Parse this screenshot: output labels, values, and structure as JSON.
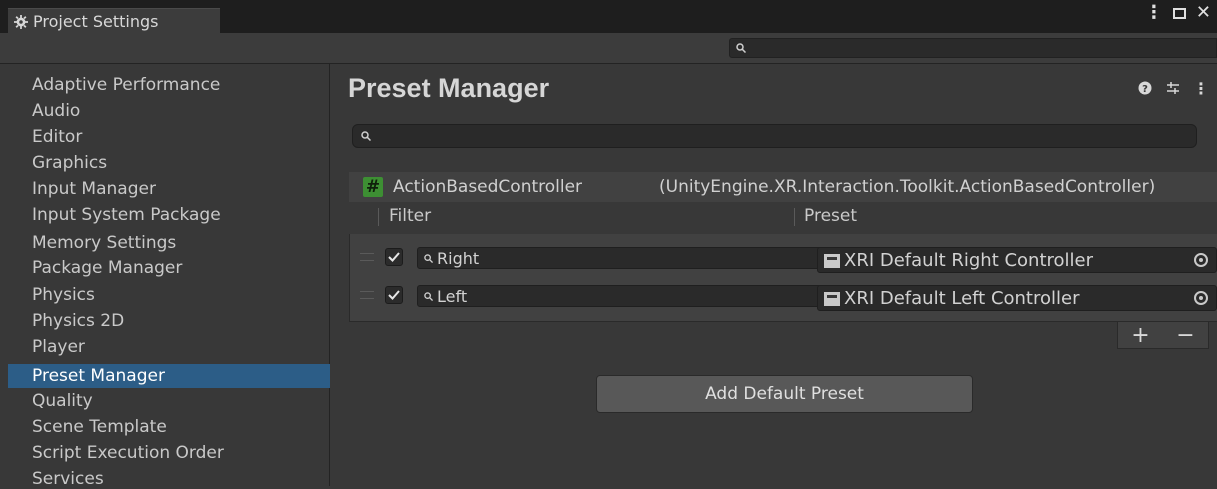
{
  "window": {
    "title": "Project Settings"
  },
  "sidebar": {
    "items": [
      {
        "label": "Adaptive Performance"
      },
      {
        "label": "Audio"
      },
      {
        "label": "Editor"
      },
      {
        "label": "Graphics"
      },
      {
        "label": "Input Manager"
      },
      {
        "label": "Input System Package"
      },
      {
        "label": "Memory Settings"
      },
      {
        "label": "Package Manager"
      },
      {
        "label": "Physics"
      },
      {
        "label": "Physics 2D"
      },
      {
        "label": "Player"
      },
      {
        "label": "Preset Manager"
      },
      {
        "label": "Quality"
      },
      {
        "label": "Scene Template"
      },
      {
        "label": "Script Execution Order"
      },
      {
        "label": "Services"
      }
    ],
    "selected": "Preset Manager"
  },
  "main": {
    "title": "Preset Manager",
    "type_header": {
      "name": "ActionBasedController",
      "full_name": "(UnityEngine.XR.Interaction.Toolkit.ActionBasedController)"
    },
    "columns": {
      "filter": "Filter",
      "preset": "Preset"
    },
    "rows": [
      {
        "checked": true,
        "filter": "Right",
        "preset": "XRI Default Right Controller"
      },
      {
        "checked": true,
        "filter": "Left",
        "preset": "XRI Default Left Controller"
      }
    ],
    "plus_label": "+",
    "minus_label": "−",
    "add_default_label": "Add Default Preset"
  },
  "colors": {
    "selection": "#2c5d87",
    "background": "#383838",
    "script_icon": "#3d8f33"
  }
}
